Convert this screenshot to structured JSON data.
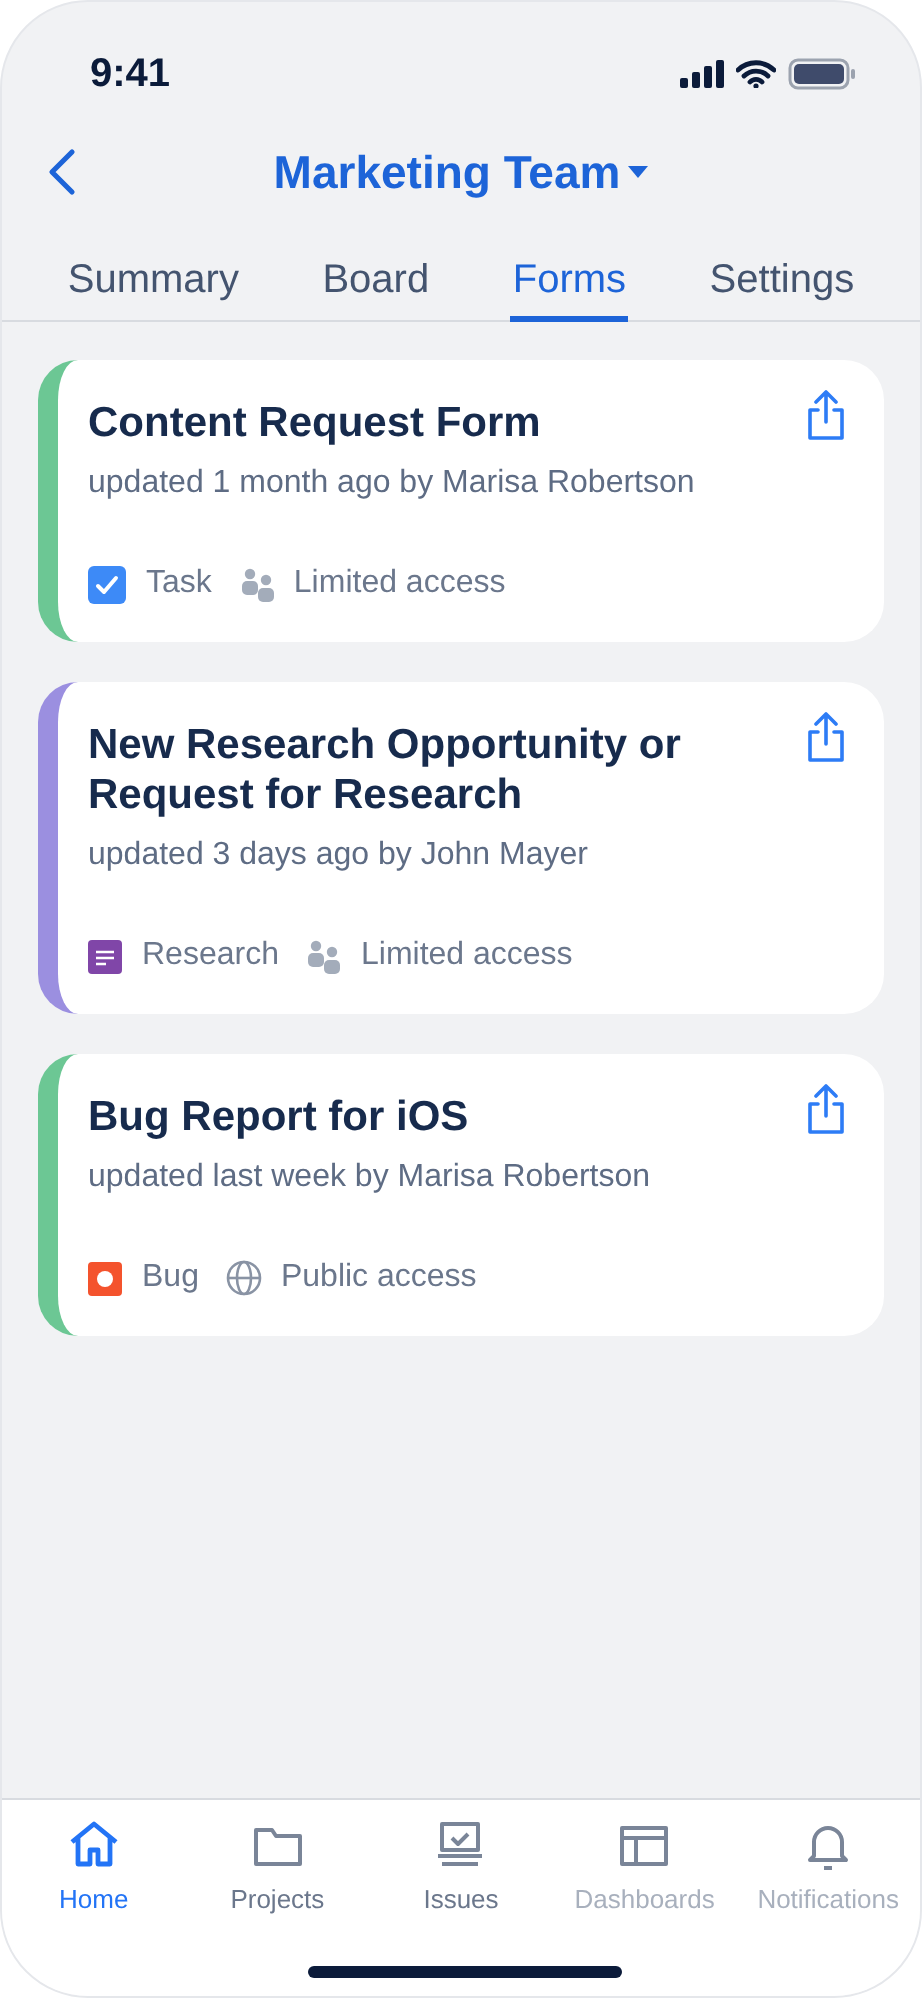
{
  "status_bar": {
    "time": "9:41"
  },
  "header": {
    "title": "Marketing Team"
  },
  "tabs": [
    {
      "label": "Summary",
      "selected": false
    },
    {
      "label": "Board",
      "selected": false
    },
    {
      "label": "Forms",
      "selected": true
    },
    {
      "label": "Settings",
      "selected": false
    }
  ],
  "forms": [
    {
      "title": "Content Request Form",
      "updated": "updated 1 month ago by Marisa Robertson",
      "color": "#6cc794",
      "type": {
        "kind": "task",
        "label": "Task"
      },
      "access": {
        "kind": "limited",
        "label": "Limited access"
      }
    },
    {
      "title": "New Research Opportunity or Request for Research",
      "updated": "updated 3 days ago by John Mayer",
      "color": "#9b8fe0",
      "type": {
        "kind": "research",
        "label": "Research"
      },
      "access": {
        "kind": "limited",
        "label": "Limited access"
      }
    },
    {
      "title": "Bug Report for iOS",
      "updated": "updated last week by Marisa Robertson",
      "color": "#6cc794",
      "type": {
        "kind": "bug",
        "label": "Bug"
      },
      "access": {
        "kind": "public",
        "label": "Public access"
      }
    }
  ],
  "bottom_nav": [
    {
      "kind": "home",
      "label": "Home",
      "selected": true,
      "disabled": false
    },
    {
      "kind": "projects",
      "label": "Projects",
      "selected": false,
      "disabled": false
    },
    {
      "kind": "issues",
      "label": "Issues",
      "selected": false,
      "disabled": false
    },
    {
      "kind": "dashboards",
      "label": "Dashboards",
      "selected": false,
      "disabled": true
    },
    {
      "kind": "notifications",
      "label": "Notifications",
      "selected": false,
      "disabled": true
    }
  ]
}
